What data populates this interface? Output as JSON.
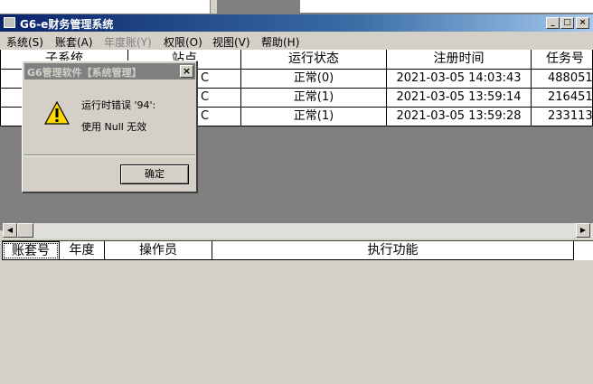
{
  "window": {
    "title": "G6-e财务管理系统",
    "controls": {
      "minimize": "_",
      "restore": "□",
      "close": "×"
    }
  },
  "menu": {
    "items": [
      {
        "label": "系统(S)",
        "disabled": false
      },
      {
        "label": "账套(A)",
        "disabled": false
      },
      {
        "label": "年度账(Y)",
        "disabled": true
      },
      {
        "label": "权限(O)",
        "disabled": false
      },
      {
        "label": "视图(V)",
        "disabled": false
      },
      {
        "label": "帮助(H)",
        "disabled": false
      }
    ]
  },
  "top_grid": {
    "columns": [
      "子系统",
      "站点",
      "运行状态",
      "注册时间",
      "任务号"
    ],
    "rows": [
      {
        "site_suffix": "C",
        "status": "正常(0)",
        "time": "2021-03-05 14:03:43",
        "task": "488051"
      },
      {
        "site_suffix": "C",
        "status": "正常(1)",
        "time": "2021-03-05 13:59:14",
        "task": "216451"
      },
      {
        "site_suffix": "C",
        "status": "正常(1)",
        "time": "2021-03-05 13:59:28",
        "task": "233113"
      }
    ]
  },
  "bottom_grid": {
    "columns": [
      "账套号",
      "年度",
      "操作员",
      "执行功能"
    ]
  },
  "dialog": {
    "title": "G6管理软件【系统管理】",
    "close": "×",
    "line1": "运行时错误 '94':",
    "line2": "使用 Null 无效",
    "ok_label": "确定",
    "icon": "warning-icon"
  },
  "colors": {
    "title_active": "#0a246a",
    "title_inactive": "#808080",
    "face": "#d4d0c8",
    "workspace": "#808080"
  }
}
